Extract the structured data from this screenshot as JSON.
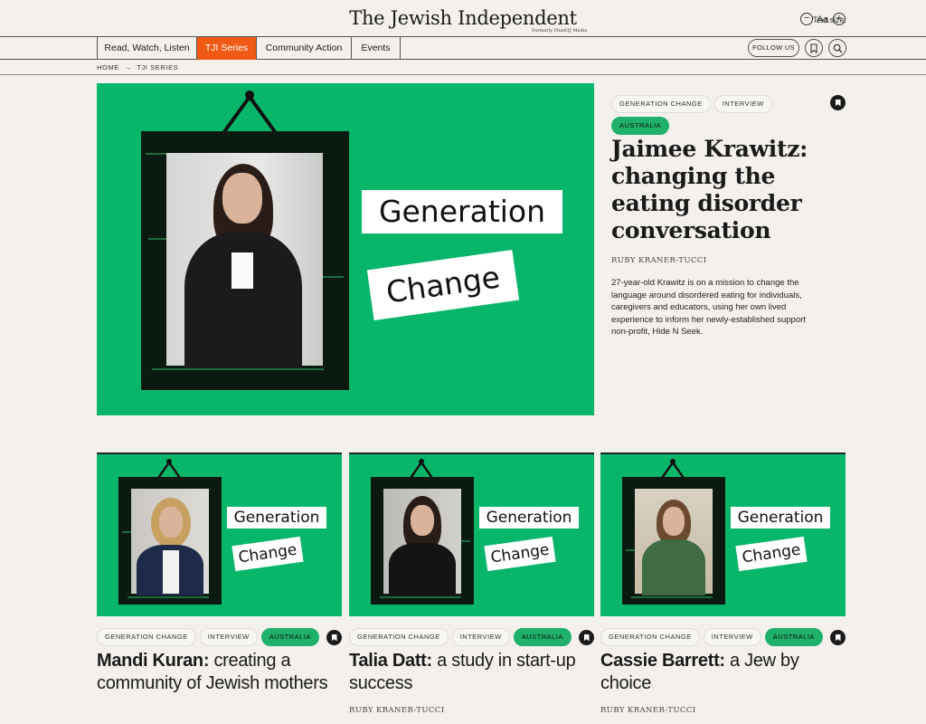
{
  "header": {
    "logo": "The Jewish Independent",
    "logo_sub": "Formerly Plus61J Media",
    "text_size_label": "Text size:",
    "text_size_minus": "−",
    "text_size_aa": "Aa",
    "text_size_plus": "+"
  },
  "nav": {
    "items": [
      {
        "label": "Read, Watch, Listen",
        "active": false
      },
      {
        "label": "TJI Series",
        "active": true
      },
      {
        "label": "Community Action",
        "active": false
      },
      {
        "label": "Events",
        "active": false
      }
    ],
    "follow_label": "FOLLOW US",
    "bookmark_icon": "bookmark-icon",
    "search_icon": "search-icon"
  },
  "breadcrumb": {
    "home": "HOME",
    "separator": "→",
    "current": "TJI SERIES"
  },
  "hero": {
    "tags": [
      "GENERATION CHANGE",
      "INTERVIEW",
      "AUSTRALIA"
    ],
    "title": "Jaimee Krawitz: changing the eating disorder conversation",
    "author": "RUBY KRANER-TUCCI",
    "description": "27-year-old Krawitz is on a mission to change the language around disordered eating for individuals, caregivers and educators, using her own lived experience to inform her newly-established support non-profit, Hide N Seek.",
    "sign_1": "Generation",
    "sign_2": "Change"
  },
  "cards": [
    {
      "tags": [
        "GENERATION CHANGE",
        "INTERVIEW",
        "AUSTRALIA"
      ],
      "title_bold": "Mandi Kuran:",
      "title_rest": " creating a community of Jewish mothers",
      "author": "",
      "sign_1": "Generation",
      "sign_2": "Change"
    },
    {
      "tags": [
        "GENERATION CHANGE",
        "INTERVIEW",
        "AUSTRALIA"
      ],
      "title_bold": "Talia Datt:",
      "title_rest": " a study in start-up success",
      "author": "RUBY KRANER-TUCCI",
      "sign_1": "Generation",
      "sign_2": "Change"
    },
    {
      "tags": [
        "GENERATION CHANGE",
        "INTERVIEW",
        "AUSTRALIA"
      ],
      "title_bold": "Cassie Barrett:",
      "title_rest": " a Jew by choice",
      "author": "RUBY KRANER-TUCCI",
      "sign_1": "Generation",
      "sign_2": "Change"
    }
  ],
  "colors": {
    "accent": "#f05a14",
    "green": "#08b66a",
    "tag_green": "#1fb06a",
    "background": "#f4f1ed"
  }
}
